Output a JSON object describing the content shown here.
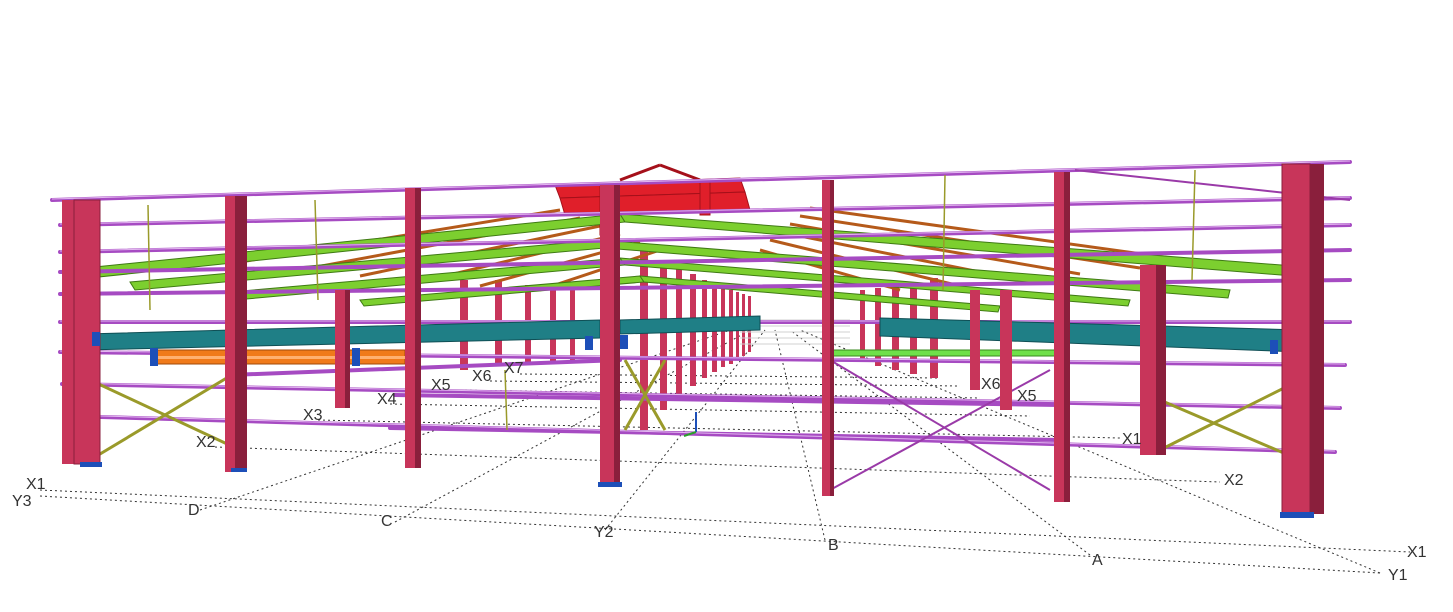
{
  "scene": {
    "colors": {
      "column": "#c8355a",
      "column_dark": "#8a1f3c",
      "girt": "#a64bc2",
      "girt_light": "#c890de",
      "brace": "#9a9a2a",
      "rafter": "#7ccf2f",
      "purlin": "#b55a1a",
      "ridge": "#e01f2a",
      "crane_beam": "#1f7f86",
      "crane_rail": "#f07a1a",
      "green_beam": "#6fe04a",
      "base_plate": "#1d4fb8",
      "grid_line": "#333333",
      "label": "#333333"
    },
    "grid_labels": {
      "x1_left": "X1",
      "y3": "Y3",
      "x2_left": "X2",
      "x3_left": "X3",
      "x4_left": "X4",
      "x5_left": "X5",
      "x6_left": "X6",
      "x7_left": "X7",
      "d": "D",
      "c": "C",
      "y2": "Y2",
      "b": "B",
      "a": "A",
      "x1_right": "X1",
      "y1": "Y1",
      "x2_right": "X2",
      "x1_right_inner": "X1",
      "x5_right": "X5",
      "x6_right": "X6"
    }
  }
}
